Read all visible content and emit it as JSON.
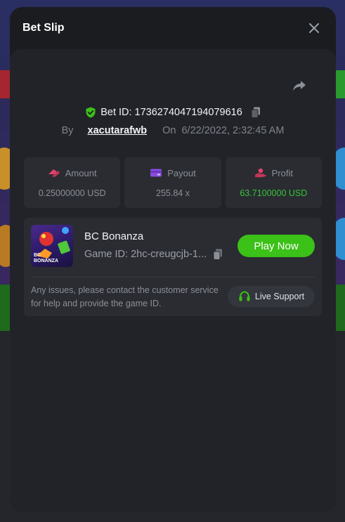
{
  "modal": {
    "title": "Bet Slip"
  },
  "bet": {
    "id_label": "Bet ID: 1736274047194079616",
    "by_label": "By",
    "user": "xacutarafwb",
    "on_label": "On",
    "date": "6/22/2022, 2:32:45 AM"
  },
  "stats": {
    "amount": {
      "label": "Amount",
      "value": "0.25000000 USD"
    },
    "payout": {
      "label": "Payout",
      "value": "255.84 x"
    },
    "profit": {
      "label": "Profit",
      "value": "63.7100000 USD"
    }
  },
  "game": {
    "name": "BC Bonanza",
    "thumb_text_line1": "BC",
    "thumb_text_line2": "BONANZA",
    "id_label": "Game ID: 2hc-creugcjb-1...",
    "play_label": "Play Now",
    "issues_text": "Any issues, please contact the customer service for help and provide the game ID.",
    "support_label": "Live Support"
  },
  "colors": {
    "accent_green": "#3bc117",
    "profit_green": "#36c436",
    "amount_icon": "#e0446a",
    "payout_icon": "#8a4de0",
    "profit_icon": "#e0446a"
  },
  "icons": {
    "close": "close-icon",
    "share": "share-icon",
    "shield": "shield-check-icon",
    "copy": "copy-icon",
    "amount": "coins-icon",
    "payout": "card-icon",
    "profit": "hand-coins-icon",
    "support": "headset-icon"
  }
}
